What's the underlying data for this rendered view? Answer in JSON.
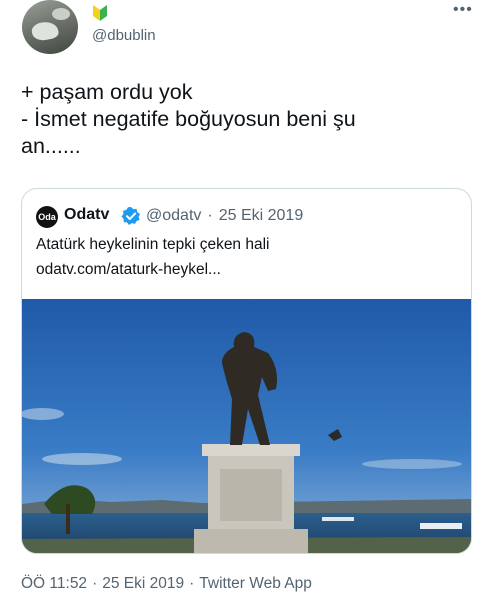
{
  "author": {
    "handle": "@dbublin",
    "avatar_icon": "profile-photo",
    "badge_icon": "green-yellow-badge-icon"
  },
  "more_icon": "more-dots-icon",
  "tweet": {
    "lines": [
      "+ paşam ordu yok",
      "- İsmet negatife boğuyosun beni şu",
      "an......"
    ]
  },
  "quote": {
    "name": "Odatv",
    "avatar_text": "Oda",
    "verified_icon": "verified-badge-icon",
    "handle": "@odatv",
    "separator": "·",
    "date": "25 Eki 2019",
    "title": "Atatürk heykelinin tepki çeken hali",
    "link": "odatv.com/ataturk-heykel...",
    "image_icon": "statue-photo"
  },
  "footer": {
    "time": "ÖÖ 11:52",
    "separator": "·",
    "date": "25 Eki 2019",
    "source": "Twitter Web App"
  },
  "colors": {
    "text": "#0f1419",
    "secondary": "#536471",
    "border": "#cfd9de",
    "verified": "#1d9bf0",
    "sky": "#2f6fbf"
  }
}
